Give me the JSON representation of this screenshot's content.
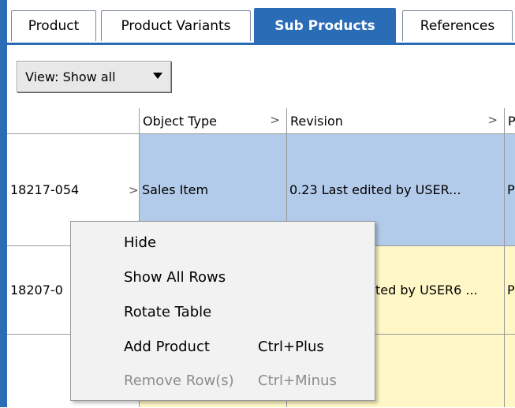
{
  "tabs": [
    {
      "label": "Product",
      "active": false
    },
    {
      "label": "Product Variants",
      "active": false
    },
    {
      "label": "Sub Products",
      "active": true
    },
    {
      "label": "References",
      "active": false
    }
  ],
  "toolbar": {
    "view_label": "View: Show all"
  },
  "table": {
    "columns": [
      "Object Type",
      "Revision",
      "P"
    ],
    "rows": [
      {
        "id": "18217-054",
        "object_type": "Sales Item",
        "revision": "0.23 Last edited by USER...",
        "extra": "P"
      },
      {
        "id": "18207-0",
        "object_type": "",
        "revision": "ted by USER6 ...",
        "extra": "P"
      },
      {
        "id": "",
        "object_type": "",
        "revision": "",
        "extra": ""
      }
    ]
  },
  "context_menu": {
    "items": [
      {
        "label": "Hide",
        "shortcut": "",
        "enabled": true
      },
      {
        "label": "Show All Rows",
        "shortcut": "",
        "enabled": true
      },
      {
        "label": "Rotate Table",
        "shortcut": "",
        "enabled": true
      },
      {
        "label": "Add Product",
        "shortcut": "Ctrl+Plus",
        "enabled": true
      },
      {
        "label": "Remove Row(s)",
        "shortcut": "Ctrl+Minus",
        "enabled": false
      }
    ]
  },
  "colors": {
    "accent": "#2b6cb6",
    "row_selected": "#b3cbea",
    "row_alt": "#fff8c6"
  }
}
